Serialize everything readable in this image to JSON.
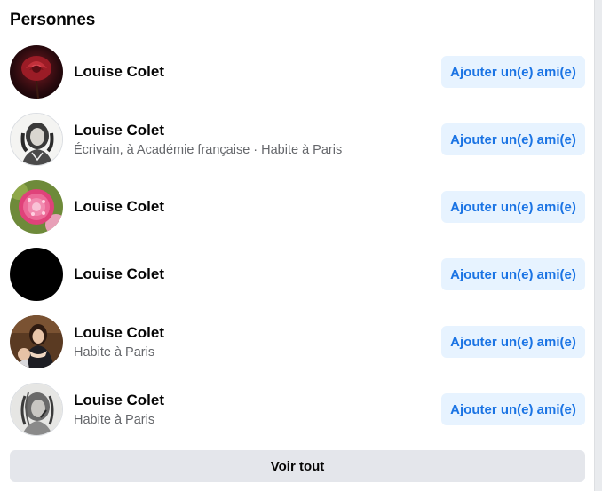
{
  "section": {
    "title": "Personnes"
  },
  "people": [
    {
      "name": "Louise Colet",
      "subtitle": "",
      "button_label": "Ajouter un(e) ami(e)",
      "avatar_icon": "rose-photo"
    },
    {
      "name": "Louise Colet",
      "subtitle": "Écrivain, à Académie française · Habite à Paris",
      "button_label": "Ajouter un(e) ami(e)",
      "avatar_icon": "portrait-engraving"
    },
    {
      "name": "Louise Colet",
      "subtitle": "",
      "button_label": "Ajouter un(e) ami(e)",
      "avatar_icon": "pink-flower-photo"
    },
    {
      "name": "Louise Colet",
      "subtitle": "",
      "button_label": "Ajouter un(e) ami(e)",
      "avatar_icon": "black-avatar"
    },
    {
      "name": "Louise Colet",
      "subtitle": "Habite à Paris",
      "button_label": "Ajouter un(e) ami(e)",
      "avatar_icon": "portrait-painting"
    },
    {
      "name": "Louise Colet",
      "subtitle": "Habite à Paris",
      "button_label": "Ajouter un(e) ami(e)",
      "avatar_icon": "portrait-sketch"
    }
  ],
  "footer": {
    "see_all_label": "Voir tout"
  },
  "colors": {
    "accent": "#1b74e4",
    "accent_bg": "#e7f3ff",
    "secondary_text": "#65676b",
    "neutral_button": "#e4e6eb"
  }
}
